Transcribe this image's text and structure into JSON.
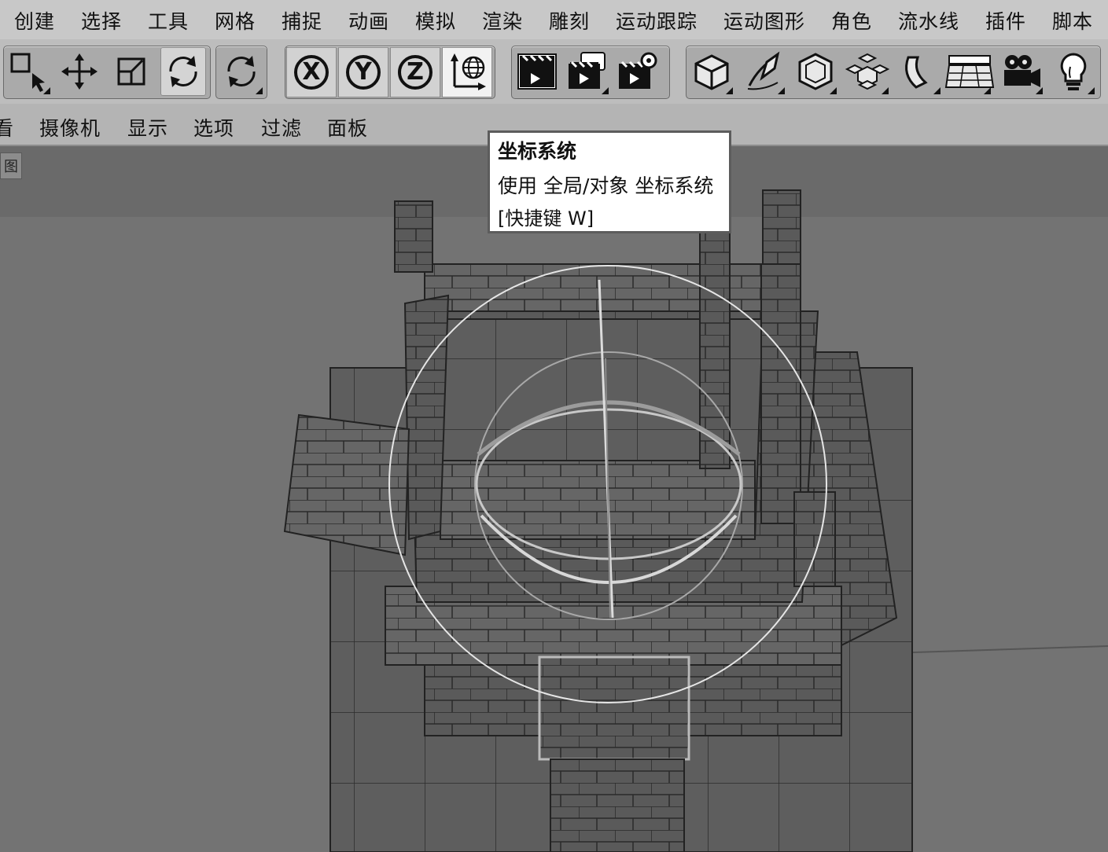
{
  "menubar": {
    "items": [
      "创建",
      "选择",
      "工具",
      "网格",
      "捕捉",
      "动画",
      "模拟",
      "渲染",
      "雕刻",
      "运动跟踪",
      "运动图形",
      "角色",
      "流水线",
      "插件",
      "脚本"
    ]
  },
  "toolbar": {
    "tools": {
      "select": "live-selection",
      "move": "move",
      "scale": "scale",
      "rotate": "rotate",
      "rotate2": "recent-tool",
      "axis_x": "X",
      "axis_y": "Y",
      "axis_z": "Z",
      "coord": "coordinate-system",
      "render_view": "render-view",
      "render_picture": "render-to-picture-viewer",
      "render_settings": "render-settings",
      "cube": "cube",
      "pen": "pen",
      "subdivision": "subdivision-surface",
      "cloner": "cloner",
      "deformer": "bend",
      "floor": "floor",
      "camera": "camera",
      "light": "light"
    }
  },
  "viewmenu": {
    "items": [
      "看",
      "摄像机",
      "显示",
      "选项",
      "过滤",
      "面板"
    ]
  },
  "viewport": {
    "panel_tag": "图"
  },
  "tooltip": {
    "title": "坐标系统",
    "description": "使用 全局/对象 坐标系统",
    "shortcut": "[快捷键 W]"
  },
  "colors": {
    "menubar_bg": "#c8c8c8",
    "toolbar_bg": "#bdbdbd",
    "viewport_bg": "#737373",
    "tooltip_bg": "#ffffff"
  }
}
